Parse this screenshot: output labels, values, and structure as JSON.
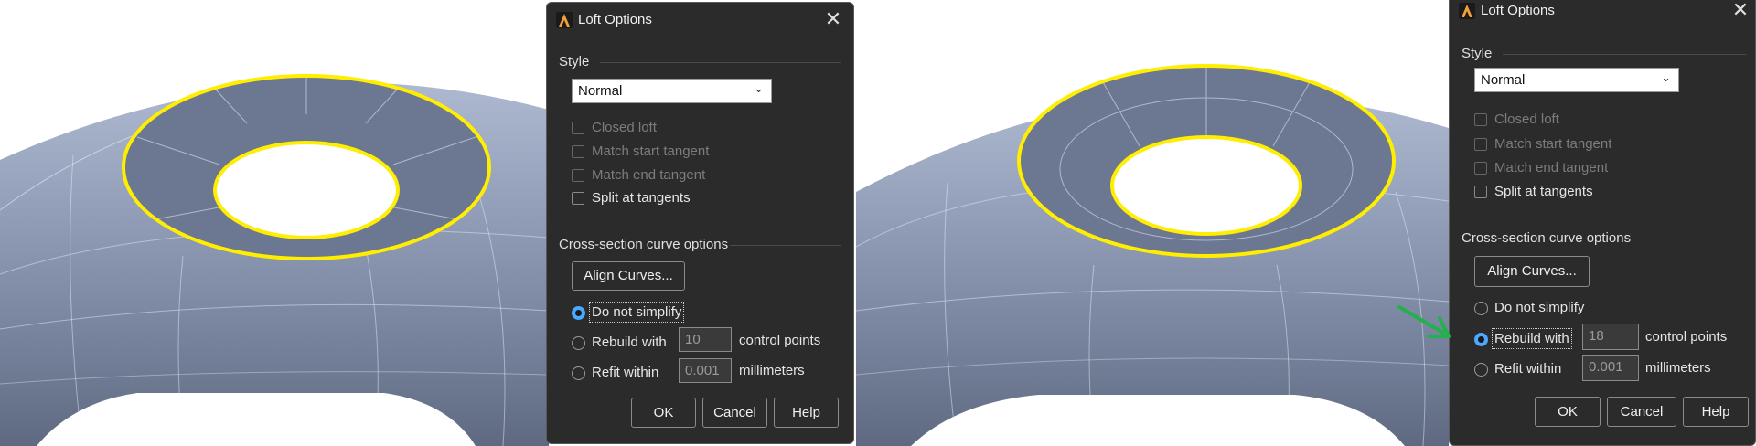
{
  "panels": [
    {
      "dialog": {
        "title": "Loft Options",
        "style_label": "Style",
        "style_value": "Normal",
        "checkboxes": [
          {
            "label": "Closed loft",
            "enabled": false,
            "checked": false
          },
          {
            "label": "Match start tangent",
            "enabled": false,
            "checked": false
          },
          {
            "label": "Match end tangent",
            "enabled": false,
            "checked": false
          },
          {
            "label": "Split at tangents",
            "enabled": true,
            "checked": false
          }
        ],
        "cross_label": "Cross-section curve options",
        "align_button": "Align Curves...",
        "radios": [
          {
            "label": "Do not simplify",
            "selected": true
          },
          {
            "label": "Rebuild with",
            "selected": false,
            "value": "10",
            "unit": "control points"
          },
          {
            "label": "Refit within",
            "selected": false,
            "value": "0.001",
            "unit": "millimeters"
          }
        ],
        "buttons": {
          "ok": "OK",
          "cancel": "Cancel",
          "help": "Help"
        }
      }
    },
    {
      "dialog": {
        "title": "Loft Options",
        "style_label": "Style",
        "style_value": "Normal",
        "checkboxes": [
          {
            "label": "Closed loft",
            "enabled": false,
            "checked": false
          },
          {
            "label": "Match start tangent",
            "enabled": false,
            "checked": false
          },
          {
            "label": "Match end tangent",
            "enabled": false,
            "checked": false
          },
          {
            "label": "Split at tangents",
            "enabled": true,
            "checked": false
          }
        ],
        "cross_label": "Cross-section curve options",
        "align_button": "Align Curves...",
        "radios": [
          {
            "label": "Do not simplify",
            "selected": false
          },
          {
            "label": "Rebuild with",
            "selected": true,
            "value": "18",
            "unit": "control points"
          },
          {
            "label": "Refit within",
            "selected": false,
            "value": "0.001",
            "unit": "millimeters"
          }
        ],
        "buttons": {
          "ok": "OK",
          "cancel": "Cancel",
          "help": "Help"
        }
      }
    }
  ],
  "colors": {
    "highlight_curve": "#ffee00",
    "annotation_arrow": "#22b14c",
    "surface": "#8e9bb6",
    "selected_radio": "#4aa8ff"
  }
}
